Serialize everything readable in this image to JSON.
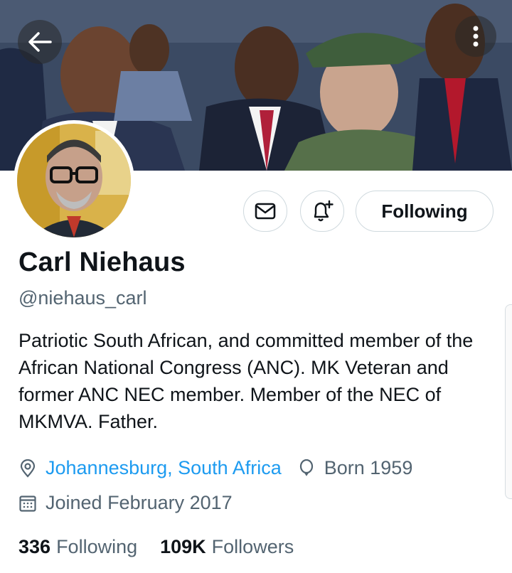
{
  "profile": {
    "name": "Carl Niehaus",
    "handle": "@niehaus_carl",
    "bio": "Patriotic South African, and committed member of the African National Congress (ANC). MK Veteran and former ANC NEC member. Member of the NEC of MKMVA. Father.",
    "location": "Johannesburg, South Africa",
    "born": "Born 1959",
    "joined": "Joined February 2017"
  },
  "actions": {
    "follow_label": "Following"
  },
  "stats": {
    "following_count": "336",
    "following_label": "Following",
    "followers_count": "109K",
    "followers_label": "Followers"
  },
  "icons": {
    "back": "arrow-left-icon",
    "more": "more-vertical-icon",
    "message": "envelope-icon",
    "notify": "bell-plus-icon",
    "location": "location-pin-icon",
    "birthday": "balloon-icon",
    "joined": "calendar-icon"
  },
  "colors": {
    "accent": "#1d9bf0",
    "secondary_text": "#536471",
    "primary_text": "#0f1419"
  }
}
